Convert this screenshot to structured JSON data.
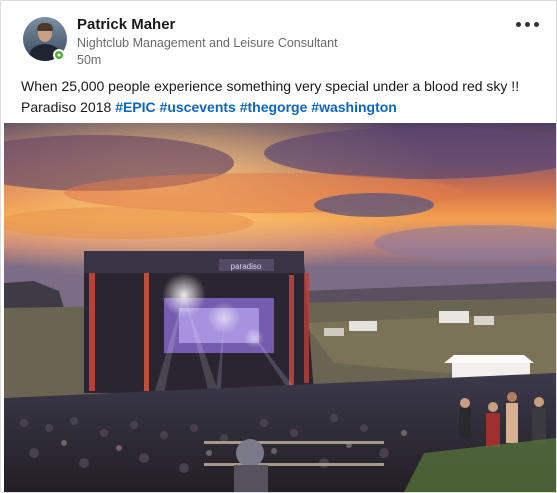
{
  "post": {
    "author": {
      "name": "Patrick Maher",
      "headline": "Nightclub Management and Leisure Consultant",
      "time": "50m",
      "avatar_icon": "profile-photo",
      "presence_status": "online",
      "presence_color": "#4caf2a"
    },
    "menu_icon": "more-horizontal-icon",
    "text": {
      "line1": "When 25,000 people experience something very special under a blood red sky !!",
      "line2_prefix": "Paradiso 2018",
      "hashtags": [
        "#EPIC",
        "#uscevents",
        "#thegorge",
        "#washington"
      ]
    },
    "image": {
      "description_icon": "concert-photo",
      "stage_sign": "paradiso"
    },
    "colors": {
      "link": "#0a66c2",
      "sky_top": "#5b4a6e",
      "sunset": "#f08a3c"
    }
  }
}
